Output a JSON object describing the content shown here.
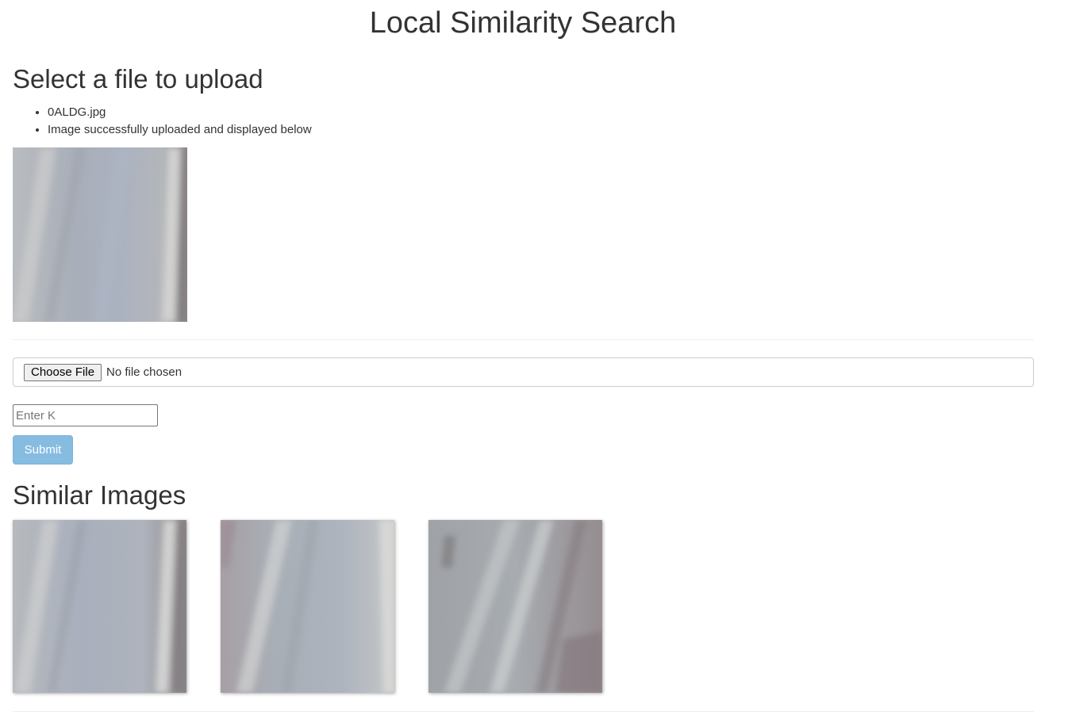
{
  "header": {
    "title": "Local Similarity Search"
  },
  "upload": {
    "heading": "Select a file to upload",
    "messages": [
      "0ALDG.jpg",
      "Image successfully uploaded and displayed below"
    ]
  },
  "form": {
    "file_button_label": "Choose File",
    "file_status": "No file chosen",
    "k_placeholder": "Enter K",
    "k_value": "",
    "submit_label": "Submit"
  },
  "results": {
    "heading": "Similar Images",
    "count": 3
  },
  "colors": {
    "text": "#333333",
    "submit_button": "#86bce0",
    "divider": "#eeeeee"
  }
}
